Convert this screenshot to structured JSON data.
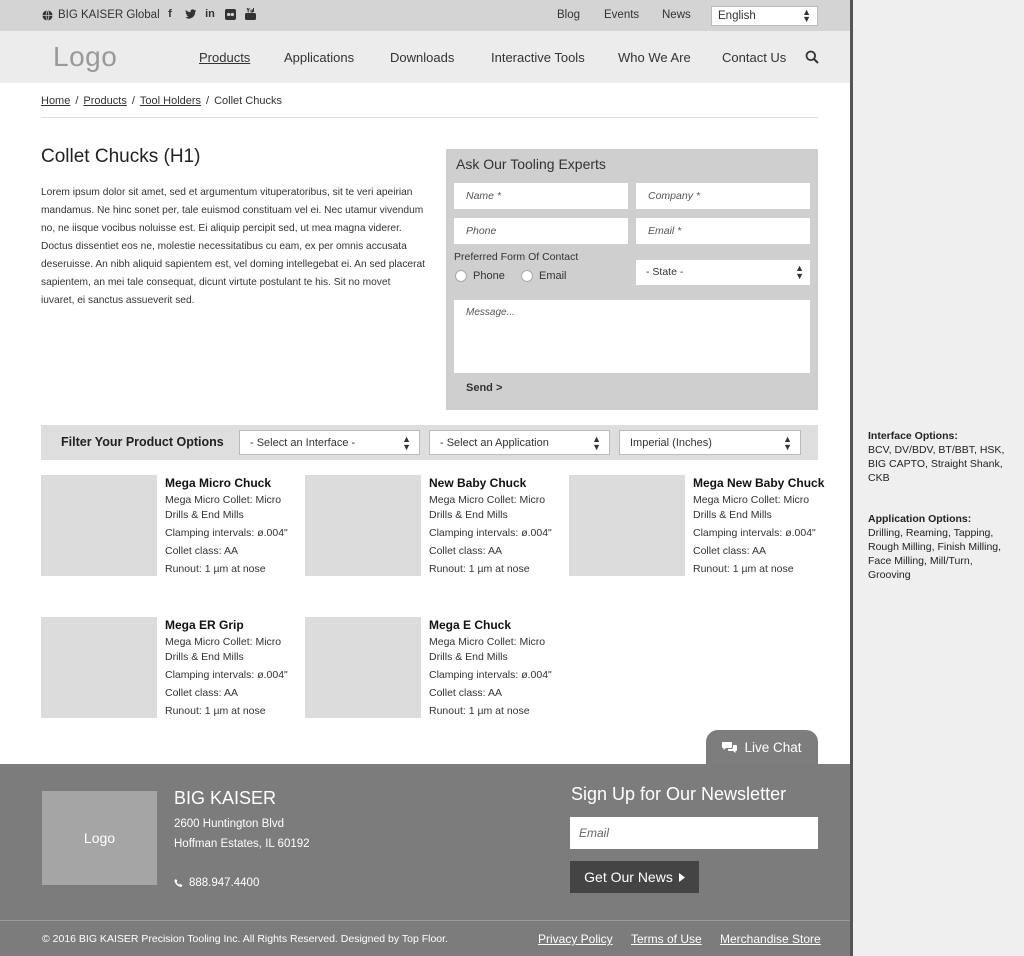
{
  "topbar": {
    "global_label": "BIG KAISER Global",
    "socials": [
      "facebook",
      "twitter",
      "linkedin",
      "flickr",
      "youtube"
    ],
    "links": [
      "Blog",
      "Events",
      "News"
    ],
    "language": "English"
  },
  "nav": {
    "logo": "Logo",
    "items": [
      "Products",
      "Applications",
      "Downloads",
      "Interactive Tools",
      "Who We Are",
      "Contact Us"
    ]
  },
  "breadcrumb": {
    "items": [
      "Home",
      "Products",
      "Tool Holders"
    ],
    "current": "Collet Chucks"
  },
  "intro": {
    "title": "Collet Chucks (H1)",
    "body": "Lorem ipsum dolor sit amet, sed et argumentum vituperatoribus, sit te veri apeirian mandamus. Ne hinc sonet per, tale euismod constituam vel ei. Nec utamur vivendum no, ne iisque vocibus noluisse est. Ei aliquip percipit sed, ut mea magna viderer. Doctus dissentiet eos ne, molestie necessitatibus cu eam, ex per omnis accusata deseruisse. An nibh aliquid sapientem est, vel doming intellegebat ei. An sed placerat sapientem, an mei tale consequat, dicunt virtute postulant te his. Sit no movet iuvaret, ei sanctus assueverit sed."
  },
  "form": {
    "title": "Ask Our Tooling Experts",
    "name_ph": "Name *",
    "company_ph": "Company *",
    "phone_ph": "Phone",
    "email_ph": "Email *",
    "preferred_label": "Preferred Form Of Contact",
    "radio_phone": "Phone",
    "radio_email": "Email",
    "state": "- State -",
    "message_ph": "Message...",
    "send": "Send >"
  },
  "filter": {
    "label": "Filter Your Product Options",
    "interface": "- Select an Interface -",
    "application": "- Select an Application",
    "units": "Imperial (Inches)"
  },
  "products": [
    {
      "name": "Mega Micro Chuck",
      "desc": "Mega Micro Collet: Micro Drills & End Mills",
      "clamping": "Clamping intervals: ø.004\"",
      "collet": "Collet class: AA",
      "runout": "Runout: 1 µm at nose"
    },
    {
      "name": "New Baby Chuck",
      "desc": "Mega Micro Collet: Micro Drills & End Mills",
      "clamping": "Clamping intervals: ø.004\"",
      "collet": "Collet class: AA",
      "runout": "Runout: 1 µm at nose"
    },
    {
      "name": "Mega New Baby Chuck",
      "desc": "Mega Micro Collet: Micro Drills & End Mills",
      "clamping": "Clamping intervals: ø.004\"",
      "collet": "Collet class: AA",
      "runout": "Runout: 1 µm at nose"
    },
    {
      "name": "Mega ER Grip",
      "desc": "Mega Micro Collet: Micro Drills & End Mills",
      "clamping": "Clamping intervals: ø.004\"",
      "collet": "Collet class: AA",
      "runout": "Runout: 1 µm at nose"
    },
    {
      "name": "Mega E Chuck",
      "desc": "Mega Micro Collet: Micro Drills & End Mills",
      "clamping": "Clamping intervals: ø.004\"",
      "collet": "Collet class: AA",
      "runout": "Runout: 1 µm at nose"
    }
  ],
  "live_chat": "Live Chat",
  "footer": {
    "logo": "Logo",
    "company": "BIG KAISER",
    "address1": "2600 Huntington Blvd",
    "address2": "Hoffman Estates, IL 60192",
    "phone": "888.947.4400",
    "newsletter_title": "Sign Up for Our Newsletter",
    "email_ph": "Email",
    "newsletter_button": "Get Our News",
    "copyright": "© 2016 BIG KAISER Precision Tooling Inc.  All Rights Reserved.  Designed by Top Floor.",
    "links": [
      "Privacy Policy",
      "Terms of Use",
      "Merchandise Store"
    ]
  },
  "annotations": {
    "interface_title": "Interface Options:",
    "interface_text": "BCV, DV/BDV, BT/BBT, HSK, BIG CAPTO, Straight Shank, CKB",
    "application_title": "Application Options:",
    "application_text": "Drilling, Reaming, Tapping, Rough Milling, Finish Milling, Face Milling, Mill/Turn, Grooving"
  }
}
